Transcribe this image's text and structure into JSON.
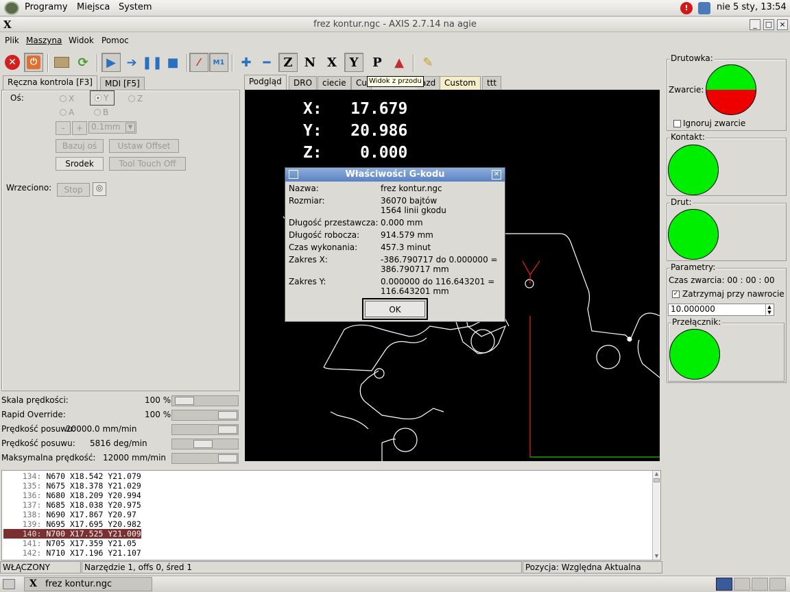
{
  "topbar": {
    "apps": "Programy",
    "places": "Miejsca",
    "system": "System",
    "clock": "nie  5 sty, 13:54"
  },
  "window": {
    "title": "frez kontur.ngc - AXIS 2.7.14 na agie"
  },
  "menu": [
    "Plik",
    "Maszyna",
    "Widok",
    "Pomoc"
  ],
  "tooltip": "Widok z przodu",
  "left_tabs": [
    "Ręczna kontrola [F3]",
    "MDI [F5]"
  ],
  "manual": {
    "axis_label": "Oś:",
    "axes": [
      "X",
      "Y",
      "Z",
      "A",
      "B"
    ],
    "minus": "-",
    "plus": "+",
    "increment": "0.1mm",
    "home_btn": "Bazuj oś",
    "offset_btn": "Ustaw Offset",
    "center_btn": "Srodek",
    "touch_btn": "Tool Touch Off",
    "spindle_label": "Wrzeciono:",
    "stop_btn": "Stop"
  },
  "overrides": [
    {
      "label": "Skala prędkości:",
      "value": "100 %",
      "level": 0.05
    },
    {
      "label": "Rapid Override:",
      "value": "100 %",
      "level": 1.0
    },
    {
      "label": "Prędkość posuwu:",
      "value": "20000.0 mm/min",
      "level": 1.0
    },
    {
      "label": "Prędkość posuwu:",
      "value": "5816 deg/min",
      "level": 0.45
    },
    {
      "label": "Maksymalna prędkość:",
      "value": "12000 mm/min",
      "level": 1.0
    }
  ],
  "view_tabs": [
    "Podgląd",
    "DRO",
    "ciecie",
    "Cu",
    "azd",
    "Custom",
    "ttt"
  ],
  "dro": [
    {
      "axis": "X:",
      "value": "17.679"
    },
    {
      "axis": "Y:",
      "value": "20.986"
    },
    {
      "axis": "Z:",
      "value": " 0.000"
    }
  ],
  "dialog": {
    "title": "Właściwości G-kodu",
    "rows": [
      {
        "label": "Nazwa:",
        "value": "frez kontur.ngc"
      },
      {
        "label": "Rozmiar:",
        "value": "36070 bajtów\n1564 linii gkodu"
      },
      {
        "label": "Długość przestawcza:",
        "value": "0.000 mm"
      },
      {
        "label": "Długość robocza:",
        "value": "914.579 mm"
      },
      {
        "label": "Czas wykonania:",
        "value": "457.3 minut"
      },
      {
        "label": "Zakres X:",
        "value": "-386.790717 do 0.000000 =\n386.790717 mm"
      },
      {
        "label": "Zakres Y:",
        "value": "0.000000 do 116.643201 =\n116.643201 mm"
      }
    ],
    "ok": "OK"
  },
  "right": {
    "drutowka": "Drutowka:",
    "zwarcie": "Zwarcie:",
    "ignoruj": "Ignoruj zwarcie",
    "kontakt": "Kontakt:",
    "drut": "Drut:",
    "parametry": "Parametry:",
    "czas": "Czas zwarcia: 00 : 00 : 00",
    "zatrzymaj": "Zatrzymaj przy nawrocie",
    "param_value": "10.000000",
    "przelacznik": "Przełącznik:",
    "colors": {
      "green": "#00ee00",
      "red": "#ee0000"
    }
  },
  "code": [
    {
      "n": "134:",
      "t": "N670 X18.542 Y21.079"
    },
    {
      "n": "135:",
      "t": "N675 X18.378 Y21.029"
    },
    {
      "n": "136:",
      "t": "N680 X18.209 Y20.994"
    },
    {
      "n": "137:",
      "t": "N685 X18.038 Y20.975"
    },
    {
      "n": "138:",
      "t": "N690 X17.867 Y20.97"
    },
    {
      "n": "139:",
      "t": "N695 X17.695 Y20.982"
    },
    {
      "n": "140:",
      "t": "N700 X17.525 Y21.009"
    },
    {
      "n": "141:",
      "t": "N705 X17.359 Y21.05"
    },
    {
      "n": "142:",
      "t": "N710 X17.196 Y21.107"
    }
  ],
  "status": {
    "state": "WŁĄCZONY",
    "tool": "Narzędzie 1, offs 0, śred 1",
    "pos": "Pozycja: Względna Aktualna"
  },
  "taskbar": {
    "item": "frez kontur.ngc"
  }
}
